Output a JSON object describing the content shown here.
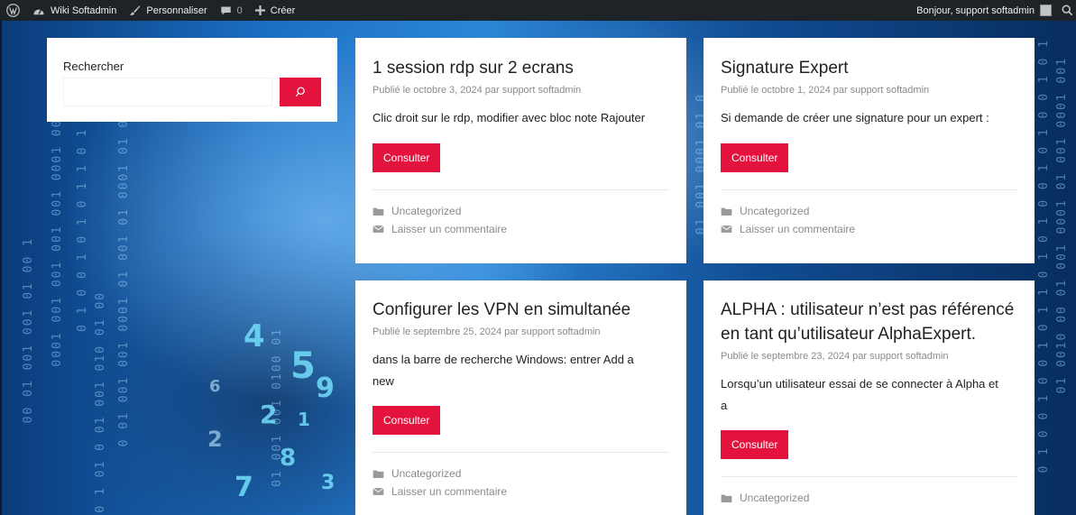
{
  "adminbar": {
    "site_name": "Wiki Softadmin",
    "customize": "Personnaliser",
    "comments_count": "0",
    "new_label": "Créer",
    "greeting": "Bonjour, support softadmin"
  },
  "search": {
    "title": "Rechercher",
    "value": "",
    "placeholder": ""
  },
  "posts": [
    {
      "title": "1 session rdp sur 2 ecrans",
      "meta": "Publié le octobre 3, 2024 par support softadmin",
      "excerpt": "Clic droit sur le rdp, modifier avec bloc note Rajouter",
      "button": "Consulter",
      "category": "Uncategorized",
      "comment": "Laisser un commentaire"
    },
    {
      "title": "Signature Expert",
      "meta": "Publié le octobre 1, 2024 par support softadmin",
      "excerpt": "Si demande de créer une signature pour un expert :",
      "button": "Consulter",
      "category": "Uncategorized",
      "comment": "Laisser un commentaire"
    },
    {
      "title": "Configurer les VPN en simultanée",
      "meta": "Publié le septembre 25, 2024 par support softadmin",
      "excerpt_l1": "dans la barre de recherche Windows: entrer Add a",
      "excerpt_l2": "new",
      "button": "Consulter",
      "category": "Uncategorized",
      "comment": "Laisser un commentaire"
    },
    {
      "title_l1": "ALPHA : utilisateur n’est pas référencé",
      "title_l2": "en tant qu’utilisateur AlphaExpert.",
      "meta": "Publié le septembre 23, 2024 par support softadmin",
      "excerpt_l1": "Lorsqu’un utilisateur essai de se connecter à Alpha et",
      "excerpt_l2": "a",
      "button": "Consulter",
      "category": "Uncategorized"
    }
  ],
  "colors": {
    "accent": "#e4133e",
    "adminbar": "#1d2327"
  }
}
